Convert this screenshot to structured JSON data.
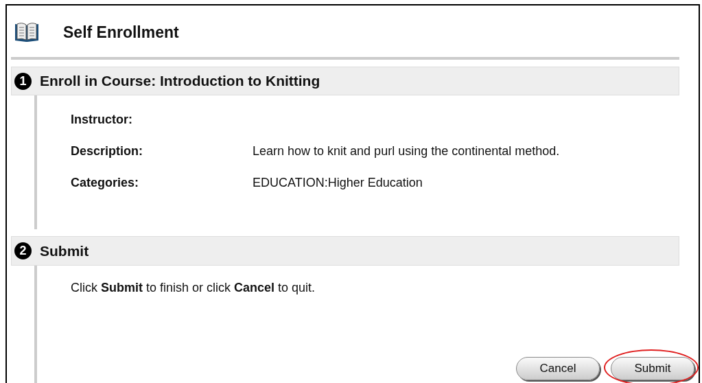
{
  "page": {
    "title": "Self Enrollment"
  },
  "steps": [
    {
      "number": "1",
      "title": "Enroll in Course: Introduction to Knitting",
      "fields": [
        {
          "label": "Instructor:"
        },
        {
          "label": "Description:",
          "value": "Learn how to knit and purl using the continental method."
        },
        {
          "label": "Categories:",
          "value": "EDUCATION:Higher Education"
        }
      ]
    },
    {
      "number": "2",
      "title": "Submit",
      "text": "Click **Submit** to finish or click **Cancel** to quit."
    }
  ],
  "buttons": [
    {
      "label": "Cancel",
      "highlighted": false
    },
    {
      "label": "Submit",
      "highlighted": true
    }
  ]
}
